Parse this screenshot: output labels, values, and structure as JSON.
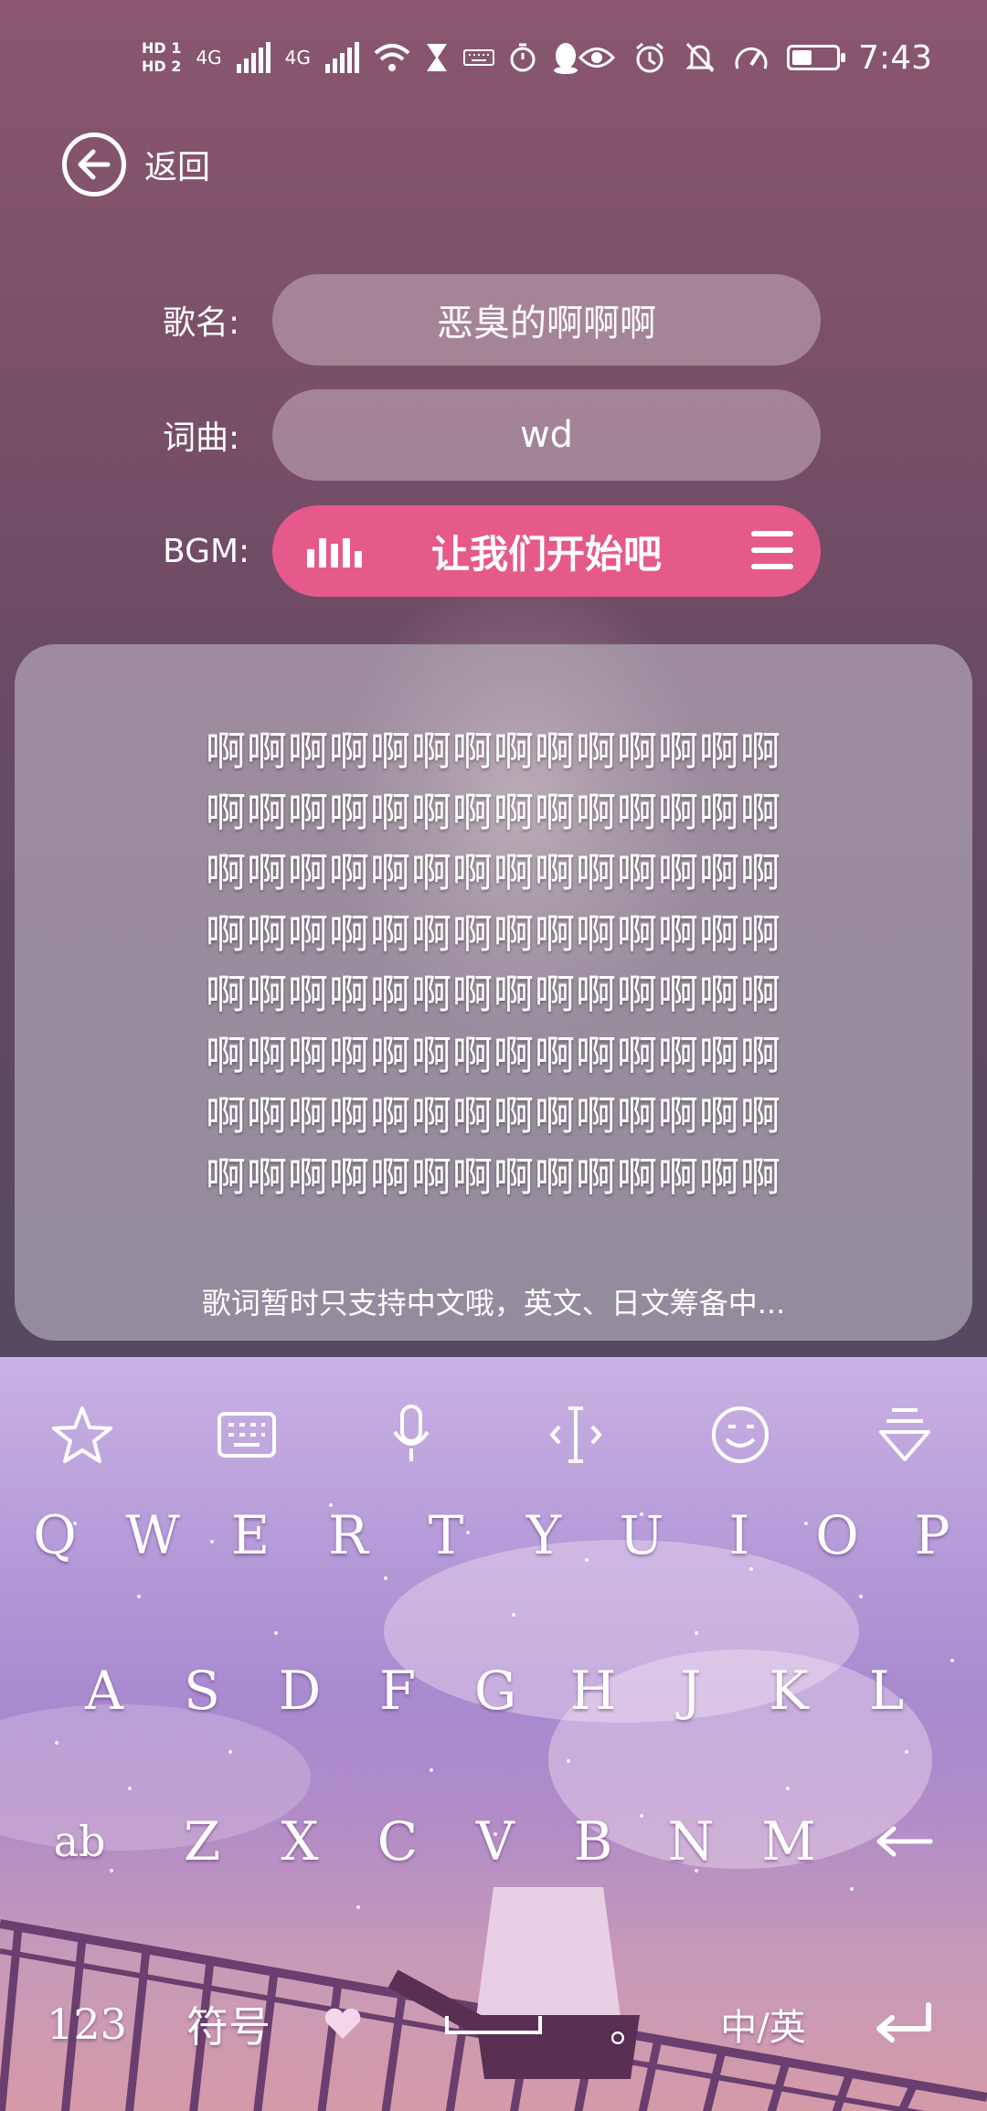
{
  "status_bar": {
    "sim1": "HD 1",
    "sim2": "HD 2",
    "net1": "4G",
    "net2": "4G",
    "time": "7:43",
    "battery_level": 0.45,
    "icons": [
      "signal-icon",
      "signal-icon",
      "wifi-icon",
      "hourglass-icon",
      "keyboard-icon",
      "stopwatch-icon",
      "qq-icon",
      "eye-icon",
      "alarm-icon",
      "mute-icon",
      "speed-icon",
      "battery-icon"
    ]
  },
  "header": {
    "back_label": "返回"
  },
  "form": {
    "song_label": "歌名:",
    "song_value": "恶臭的啊啊啊",
    "lyricist_label": "词曲:",
    "lyricist_value": "wd",
    "bgm_label": "BGM:",
    "bgm_value": "让我们开始吧"
  },
  "lyrics": {
    "lines": [
      "啊啊啊啊啊啊啊啊啊啊啊啊啊啊",
      "啊啊啊啊啊啊啊啊啊啊啊啊啊啊",
      "啊啊啊啊啊啊啊啊啊啊啊啊啊啊",
      "啊啊啊啊啊啊啊啊啊啊啊啊啊啊",
      "啊啊啊啊啊啊啊啊啊啊啊啊啊啊",
      "啊啊啊啊啊啊啊啊啊啊啊啊啊啊",
      "啊啊啊啊啊啊啊啊啊啊啊啊啊啊",
      "啊啊啊啊啊啊啊啊啊啊啊啊啊啊"
    ],
    "note": "歌词暂时只支持中文哦，英文、日文筹备中..."
  },
  "keyboard": {
    "toolbar": [
      "star-icon",
      "keyboard-icon",
      "microphone-icon",
      "cursor-icon",
      "emoji-icon",
      "collapse-icon"
    ],
    "row1": [
      "Q",
      "W",
      "E",
      "R",
      "T",
      "Y",
      "U",
      "I",
      "O",
      "P"
    ],
    "row2": [
      "A",
      "S",
      "D",
      "F",
      "G",
      "H",
      "J",
      "K",
      "L"
    ],
    "row3": [
      "Z",
      "X",
      "C",
      "V",
      "B",
      "N",
      "M"
    ],
    "shift_label": "ab",
    "num_label": "123",
    "symbol_label": "符号",
    "period_label": "。",
    "lang_label": "中/英"
  }
}
